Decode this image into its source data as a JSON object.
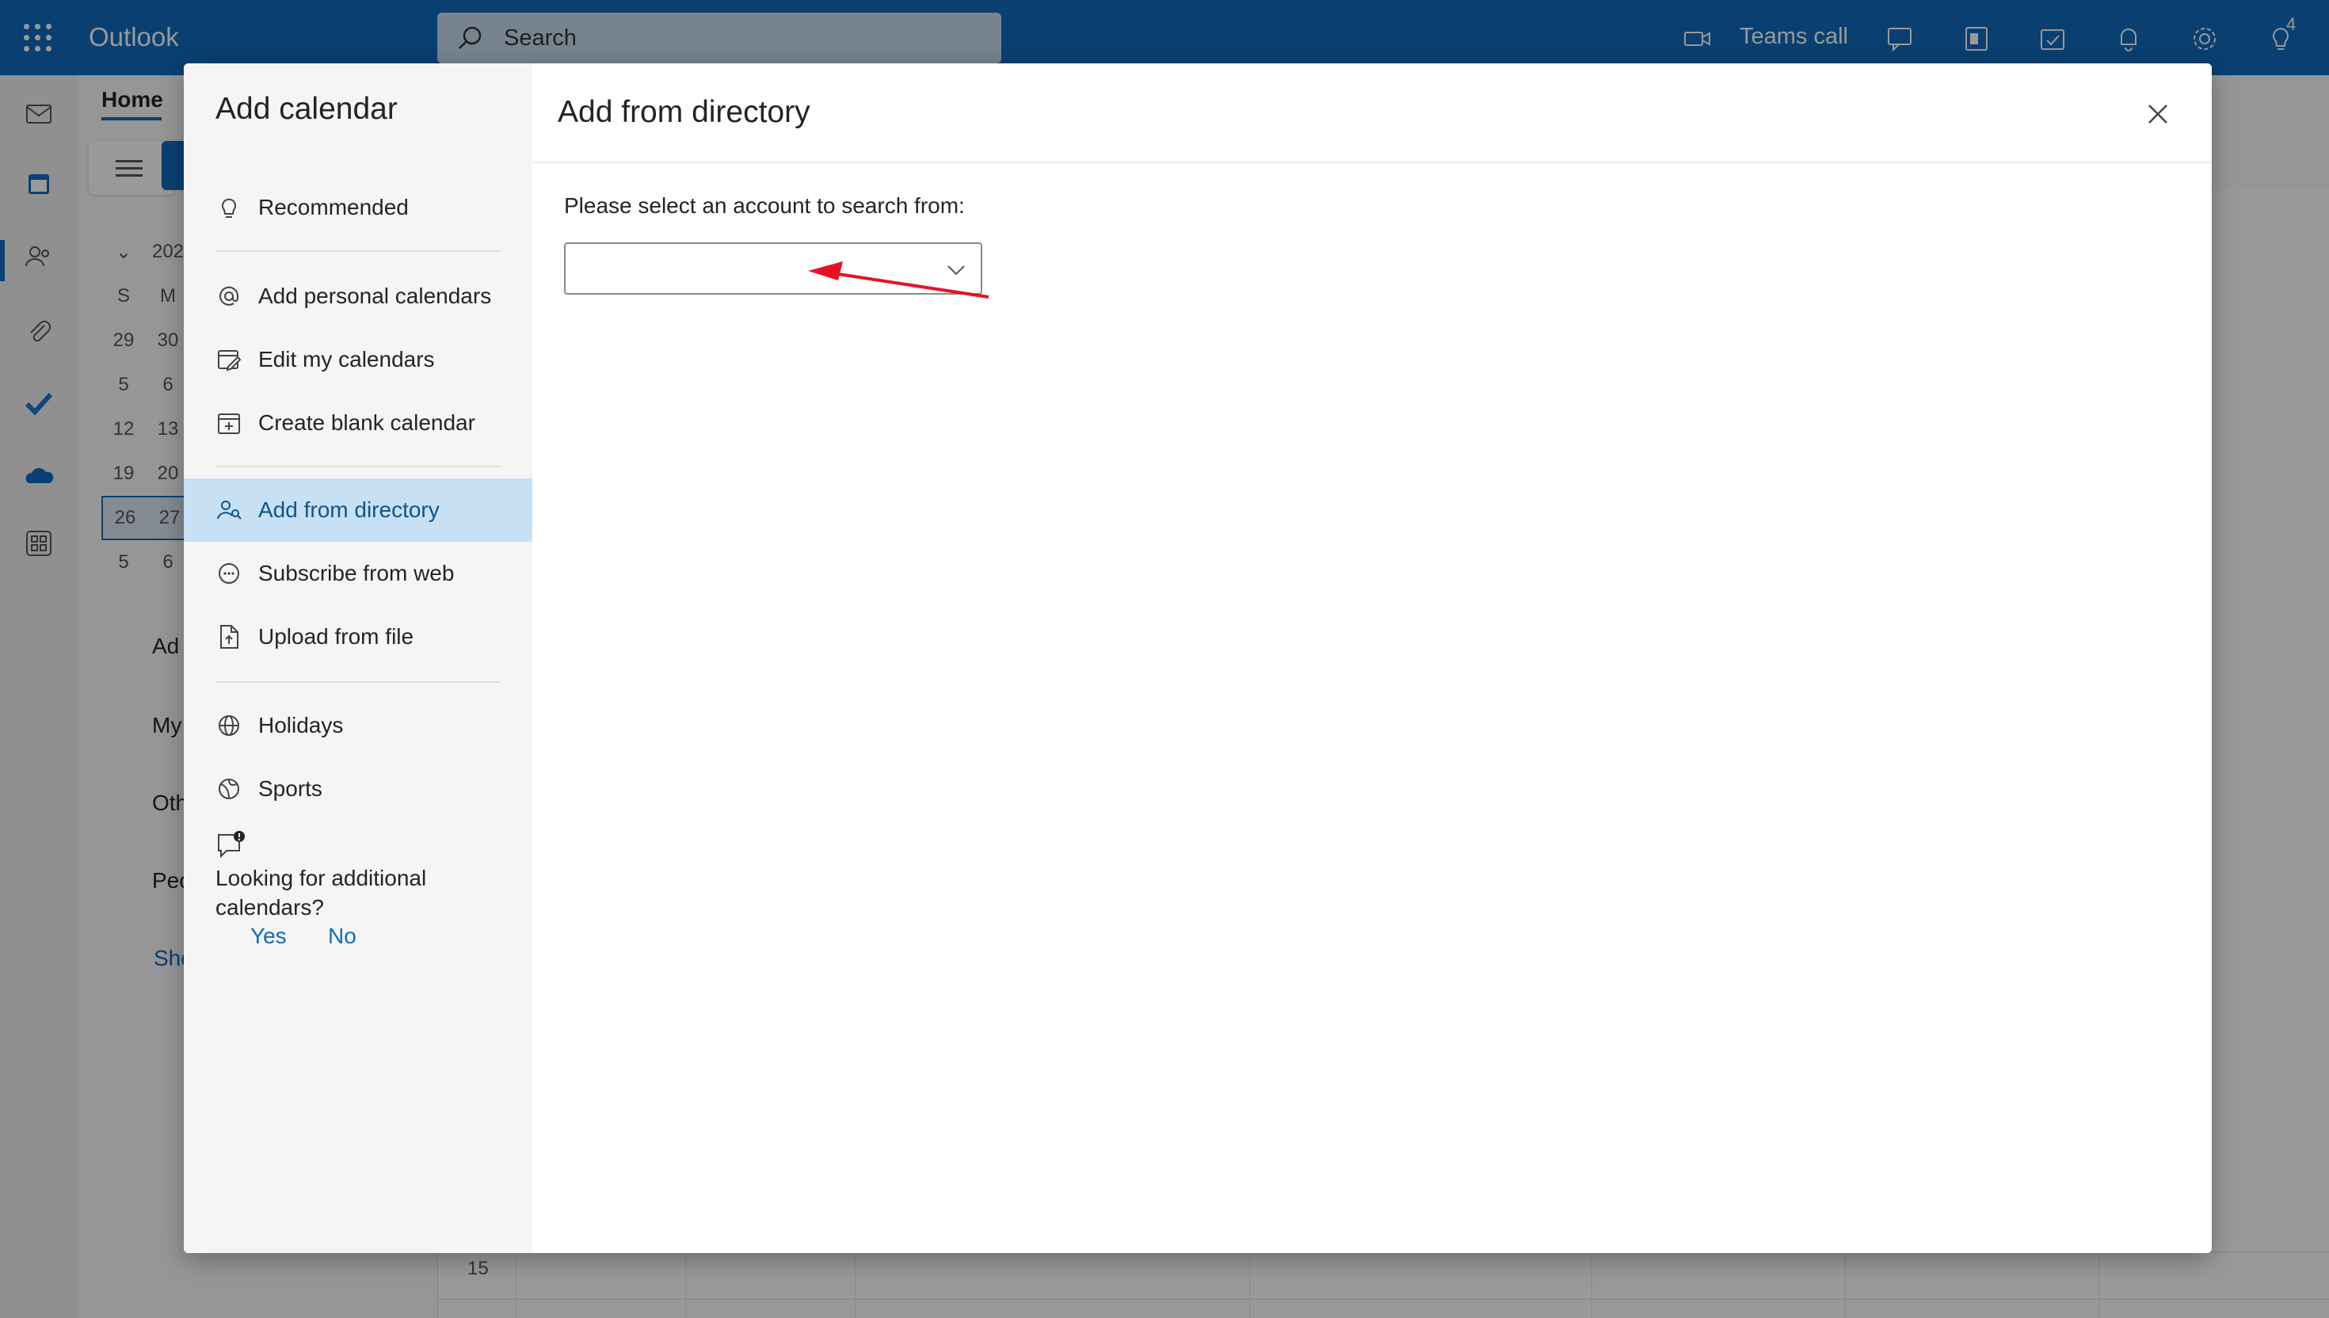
{
  "app": {
    "name": "Outlook"
  },
  "search": {
    "placeholder": "Search"
  },
  "topbar": {
    "teams_call_label": "Teams call",
    "tips_badge": "4"
  },
  "background": {
    "home_tab": "Home",
    "minical_year_partial": "202",
    "minical_weekdays": [
      "S",
      "M"
    ],
    "minical_rows": [
      [
        "29",
        "30"
      ],
      [
        "5",
        "6"
      ],
      [
        "12",
        "13"
      ],
      [
        "19",
        "20"
      ],
      [
        "26",
        "27"
      ],
      [
        "5",
        "6"
      ]
    ],
    "side_items": [
      "Ad",
      "My",
      "Oth",
      "Peo",
      "Sho"
    ],
    "hour_label": "15"
  },
  "dialog": {
    "title": "Add calendar",
    "nav": {
      "recommended": "Recommended",
      "add_personal": "Add personal calendars",
      "edit_my": "Edit my calendars",
      "create_blank": "Create blank calendar",
      "add_directory": "Add from directory",
      "subscribe_web": "Subscribe from web",
      "upload_file": "Upload from file",
      "holidays": "Holidays",
      "sports": "Sports"
    },
    "feedback": {
      "question": "Looking for additional calendars?",
      "yes": "Yes",
      "no": "No"
    },
    "content": {
      "title": "Add from directory",
      "prompt": "Please select an account to search from:",
      "account_value": ""
    }
  },
  "colors": {
    "brand": "#0f6cbd",
    "active_nav_bg": "#c7e0f4",
    "annotation_arrow": "#e81123"
  }
}
